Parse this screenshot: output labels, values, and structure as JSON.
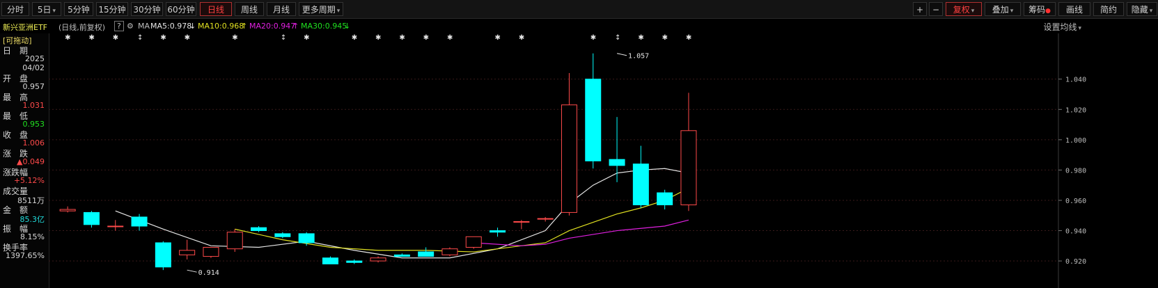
{
  "toolbar": {
    "periods": [
      "分时",
      "5日",
      "5分钟",
      "15分钟",
      "30分钟",
      "60分钟",
      "日线",
      "周线",
      "月线",
      "更多周期"
    ],
    "active_period": "日线",
    "right_tools": [
      "复权",
      "叠加",
      "筹码",
      "画线",
      "简约",
      "隐藏"
    ],
    "plus": "+",
    "minus": "−"
  },
  "info": {
    "name": "新兴亚洲ETF",
    "mode": "(日线,前复权)",
    "help": "?",
    "ma_label": "MA",
    "ma5": "MA5:0.978",
    "ma10": "MA10:0.968",
    "ma20": "MA20:0.947",
    "ma30": "MA30:0.945",
    "setting": "设置均线"
  },
  "panel": {
    "drag_label": "[可拖动]",
    "date_label": "日　期",
    "date_year": "2025",
    "date_md": "04/02",
    "open_label": "开　盘",
    "open": "0.957",
    "high_label": "最　高",
    "high": "1.031",
    "low_label": "最　低",
    "low": "0.953",
    "close_label": "收　盘",
    "close": "1.006",
    "change_label": "涨　跌",
    "change": "▲0.049",
    "pct_label": "涨跌幅",
    "pct": "+5.12%",
    "vol_label": "成交量",
    "vol": "8511万",
    "amount_label": "金　额",
    "amount": "85.3亿",
    "amp_label": "振　幅",
    "amp": "8.15%",
    "turnover_label": "换手率",
    "turnover": "1397.65%"
  },
  "colors": {
    "up": "#ff4a4a",
    "down": "#00ffff",
    "ma5": "#e6e6e6",
    "ma10": "#e0e020",
    "ma20": "#e020e0",
    "ma30": "#20e020",
    "grid": "#3a1a1a"
  },
  "chart_data": {
    "type": "candlestick",
    "ylim": [
      0.915,
      1.061
    ],
    "yticks": [
      0.92,
      0.94,
      0.96,
      0.98,
      1.0,
      1.02,
      1.04
    ],
    "candles": [
      {
        "o": 0.953,
        "h": 0.956,
        "l": 0.952,
        "c": 0.954
      },
      {
        "o": 0.952,
        "h": 0.953,
        "l": 0.942,
        "c": 0.944
      },
      {
        "o": 0.943,
        "h": 0.947,
        "l": 0.94,
        "c": 0.943
      },
      {
        "o": 0.949,
        "h": 0.951,
        "l": 0.94,
        "c": 0.943
      },
      {
        "o": 0.932,
        "h": 0.933,
        "l": 0.914,
        "c": 0.916
      },
      {
        "o": 0.924,
        "h": 0.934,
        "l": 0.921,
        "c": 0.927
      },
      {
        "o": 0.923,
        "h": 0.929,
        "l": 0.922,
        "c": 0.929
      },
      {
        "o": 0.928,
        "h": 0.941,
        "l": 0.926,
        "c": 0.939
      },
      {
        "o": 0.942,
        "h": 0.943,
        "l": 0.939,
        "c": 0.94
      },
      {
        "o": 0.938,
        "h": 0.939,
        "l": 0.935,
        "c": 0.936
      },
      {
        "o": 0.938,
        "h": 0.939,
        "l": 0.93,
        "c": 0.932
      },
      {
        "o": 0.922,
        "h": 0.923,
        "l": 0.918,
        "c": 0.918
      },
      {
        "o": 0.92,
        "h": 0.921,
        "l": 0.918,
        "c": 0.919
      },
      {
        "o": 0.92,
        "h": 0.923,
        "l": 0.919,
        "c": 0.922
      },
      {
        "o": 0.924,
        "h": 0.925,
        "l": 0.923,
        "c": 0.923
      },
      {
        "o": 0.926,
        "h": 0.929,
        "l": 0.923,
        "c": 0.923
      },
      {
        "o": 0.924,
        "h": 0.929,
        "l": 0.923,
        "c": 0.928
      },
      {
        "o": 0.929,
        "h": 0.935,
        "l": 0.928,
        "c": 0.936
      },
      {
        "o": 0.94,
        "h": 0.942,
        "l": 0.936,
        "c": 0.939
      },
      {
        "o": 0.946,
        "h": 0.947,
        "l": 0.941,
        "c": 0.946
      },
      {
        "o": 0.948,
        "h": 0.949,
        "l": 0.946,
        "c": 0.948
      },
      {
        "o": 0.952,
        "h": 1.044,
        "l": 0.95,
        "c": 1.023
      },
      {
        "o": 1.04,
        "h": 1.057,
        "l": 0.981,
        "c": 0.986
      },
      {
        "o": 0.987,
        "h": 1.015,
        "l": 0.972,
        "c": 0.983
      },
      {
        "o": 0.984,
        "h": 0.996,
        "l": 0.955,
        "c": 0.957
      },
      {
        "o": 0.965,
        "h": 0.967,
        "l": 0.954,
        "c": 0.957
      },
      {
        "o": 0.957,
        "h": 1.031,
        "l": 0.953,
        "c": 1.006
      }
    ],
    "ma5": [
      [
        2,
        0.953
      ],
      [
        4,
        0.941
      ],
      [
        6,
        0.93
      ],
      [
        8,
        0.929
      ],
      [
        10,
        0.933
      ],
      [
        12,
        0.927
      ],
      [
        14,
        0.922
      ],
      [
        16,
        0.922
      ],
      [
        18,
        0.928
      ],
      [
        20,
        0.94
      ],
      [
        21,
        0.958
      ],
      [
        22,
        0.97
      ],
      [
        23,
        0.978
      ],
      [
        24,
        0.98
      ],
      [
        25,
        0.981
      ],
      [
        26,
        0.978
      ]
    ],
    "ma10": [
      [
        7,
        0.941
      ],
      [
        9,
        0.934
      ],
      [
        11,
        0.929
      ],
      [
        13,
        0.927
      ],
      [
        15,
        0.927
      ],
      [
        17,
        0.926
      ],
      [
        19,
        0.93
      ],
      [
        20,
        0.932
      ],
      [
        21,
        0.94
      ],
      [
        23,
        0.951
      ],
      [
        24,
        0.955
      ],
      [
        25,
        0.96
      ],
      [
        26,
        0.968
      ]
    ],
    "ma20": [
      [
        17,
        0.932
      ],
      [
        19,
        0.93
      ],
      [
        20,
        0.931
      ],
      [
        21,
        0.935
      ],
      [
        23,
        0.94
      ],
      [
        25,
        0.943
      ],
      [
        26,
        0.947
      ]
    ],
    "markers_star": [
      0,
      1,
      2,
      4,
      5,
      7,
      10,
      12,
      13,
      14,
      15,
      16,
      18,
      19,
      22,
      24,
      25,
      26
    ],
    "markers_updown": [
      3,
      9,
      23
    ],
    "annotations": [
      {
        "i": 23,
        "v": 1.057,
        "text": "1.057"
      },
      {
        "i": 5,
        "v": 0.914,
        "text": "0.914"
      }
    ]
  }
}
